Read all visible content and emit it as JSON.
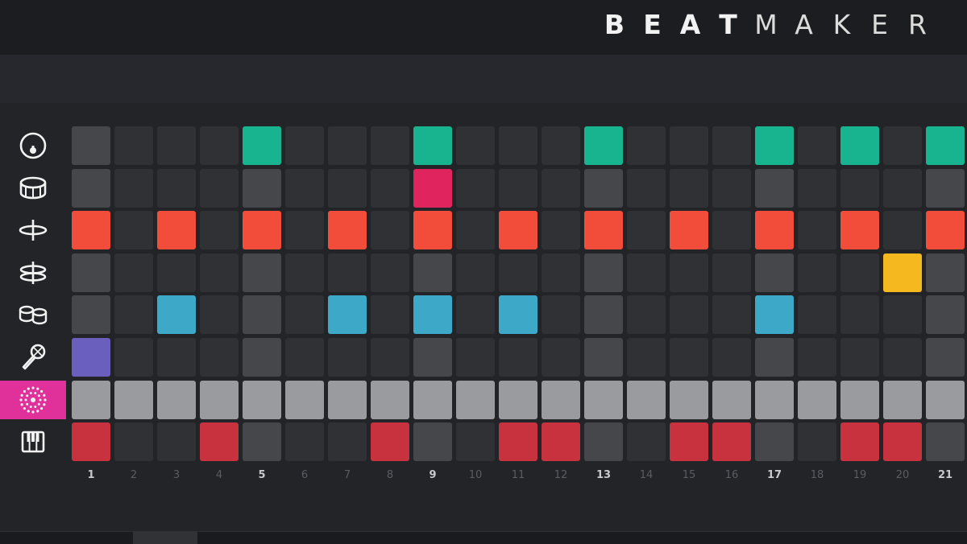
{
  "app": {
    "logo_bold": [
      "B",
      "E",
      "A",
      "T"
    ],
    "logo_light": [
      "M",
      "A",
      "K",
      "E",
      "R"
    ]
  },
  "colors": {
    "background": "#222428",
    "header": "#1c1d21",
    "pad_off": "#303135",
    "pad_off_beat": "#45474b",
    "active_instrument": "#e0309a"
  },
  "instruments": [
    {
      "name": "kick",
      "icon": "kick-drum-icon",
      "color": "#18b38f",
      "active": false,
      "steps": [
        5,
        9,
        13,
        17,
        19,
        21
      ]
    },
    {
      "name": "snare",
      "icon": "snare-drum-icon",
      "color": "#e0245e",
      "active": false,
      "steps": [
        9
      ]
    },
    {
      "name": "hi-hat",
      "icon": "hihat-icon",
      "color": "#f24d3a",
      "active": false,
      "steps": [
        1,
        3,
        5,
        7,
        9,
        11,
        13,
        15,
        17,
        19,
        21
      ]
    },
    {
      "name": "cymbal",
      "icon": "cymbal-icon",
      "color": "#f6b81f",
      "active": false,
      "steps": [
        20
      ]
    },
    {
      "name": "toms",
      "icon": "toms-icon",
      "color": "#3ea8c9",
      "active": false,
      "steps": [
        3,
        7,
        9,
        11,
        17
      ]
    },
    {
      "name": "vocal",
      "icon": "microphone-icon",
      "color": "#6b5fbe",
      "active": false,
      "steps": [
        1
      ]
    },
    {
      "name": "fx",
      "icon": "sparkle-circle-icon",
      "color": "#9a9b9e",
      "active": true,
      "steps": [
        1,
        2,
        3,
        4,
        5,
        6,
        7,
        8,
        9,
        10,
        11,
        12,
        13,
        14,
        15,
        16,
        17,
        18,
        19,
        20,
        21
      ]
    },
    {
      "name": "keys",
      "icon": "piano-keys-icon",
      "color": "#c8313e",
      "active": false,
      "steps": [
        1,
        4,
        8,
        11,
        12,
        15,
        16,
        19,
        20
      ]
    }
  ],
  "steps": [
    "1",
    "2",
    "3",
    "4",
    "5",
    "6",
    "7",
    "8",
    "9",
    "10",
    "11",
    "12",
    "13",
    "14",
    "15",
    "16",
    "17",
    "18",
    "19",
    "20",
    "21"
  ],
  "beat_steps": [
    1,
    5,
    9,
    13,
    17,
    21
  ]
}
